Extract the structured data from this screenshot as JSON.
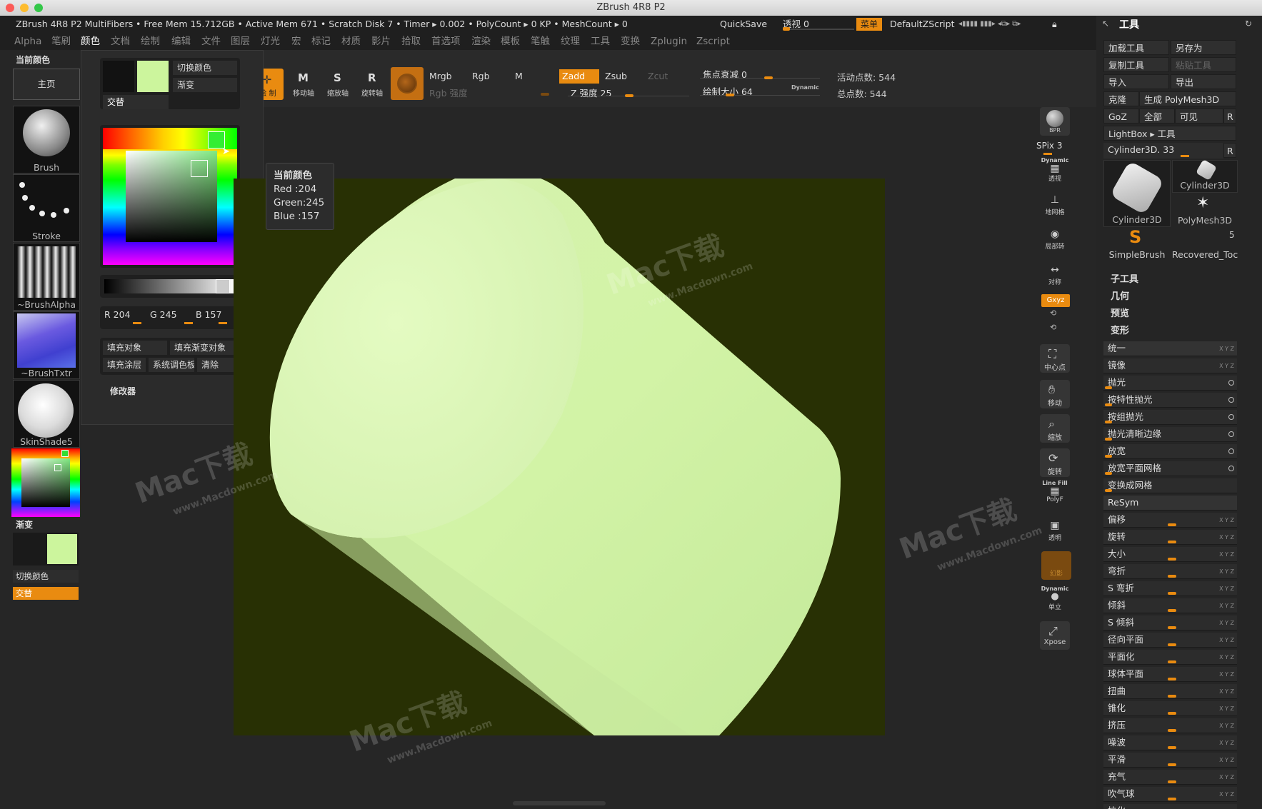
{
  "window_title": "ZBrush 4R8 P2",
  "info": {
    "app_name": "ZBrush 4R8 P2 MultiFibers",
    "stats": "• Free Mem 15.712GB • Active Mem 671 • Scratch Disk 7 • Timer ▸ 0.002 • PolyCount ▸ 0 KP • MeshCount ▸ 0",
    "quicksave": "QuickSave",
    "perspective": "透视 0",
    "menus_btn": "菜单",
    "default_script": "DefaultZScript"
  },
  "menu": [
    "Alpha",
    "笔刷",
    "颜色",
    "文档",
    "绘制",
    "编辑",
    "文件",
    "图层",
    "灯光",
    "宏",
    "标记",
    "材质",
    "影片",
    "拾取",
    "首选项",
    "渲染",
    "模板",
    "笔触",
    "纹理",
    "工具",
    "变换",
    "Zplugin",
    "Zscript"
  ],
  "menu_active_index": 2,
  "shelf": {
    "draw": "绘 制",
    "move": "移动轴",
    "scale": "缩放轴",
    "rotate": "旋转轴",
    "mrgb": "Mrgb",
    "rgb": "Rgb",
    "m": "M",
    "rgb_intensity": "Rgb 强度",
    "zadd": "Zadd",
    "zsub": "Zsub",
    "zcut": "Zcut",
    "z_intensity": "Z 强度 25",
    "focal_shift": "焦点衰减 0",
    "draw_size": "绘制大小 64",
    "dynamic": "Dynamic",
    "active_points": "活动点数: 544",
    "total_points": "总点数: 544"
  },
  "left_tray": {
    "current_color": "当前颜色",
    "home": "主页",
    "brush": "Brush",
    "stroke": "Stroke",
    "alpha": "~BrushAlpha",
    "texture": "~BrushTxtr",
    "material": "SkinShade5",
    "gradient": "渐变",
    "switch_color": "切换颜色",
    "alternate": "交替"
  },
  "color_popup": {
    "switch_color": "切换颜色",
    "gradient": "渐变",
    "alternate": "交替",
    "r": "R 204",
    "g": "G 245",
    "b": "B 157",
    "fill_object": "填充对象",
    "fill_gradient": "填充渐变对象",
    "fill_layer": "填充涂层",
    "sys_palette": "系统调色板",
    "clear": "清除",
    "modifiers": "修改器",
    "current_hex": "#ccf59d"
  },
  "tooltip": {
    "title": "当前颜色",
    "red": "Red  :204",
    "green": "Green:245",
    "blue": "Blue :157"
  },
  "right_shelf": {
    "bpr": "BPR",
    "spix": "SPix 3",
    "dynamic": "Dynamic",
    "persp": "透视",
    "floor": "地网格",
    "local": "局部转",
    "sym": "对称",
    "xyz": "Gxyz",
    "frame": "中心点",
    "move": "移动",
    "zoom": "缩放",
    "rotate": "旋转",
    "linefill": "Line Fill",
    "polyf": "PolyF",
    "transp": "透明",
    "ghost": "幻影",
    "solo": "单立",
    "xpose": "Xpose"
  },
  "tool_panel": {
    "title": "工具",
    "load_tool": "加载工具",
    "save_as": "另存为",
    "copy_tool": "复制工具",
    "paste_tool": "粘贴工具",
    "import": "导入",
    "export": "导出",
    "clone": "克隆",
    "make_polymesh": "生成 PolyMesh3D",
    "goz": "GoZ",
    "all": "全部",
    "visible": "可见",
    "r": "R",
    "lightbox": "LightBox ▸ 工具",
    "current_tool": "Cylinder3D. 33",
    "tools": [
      "Cylinder3D",
      "Cylinder3D",
      "PolyMesh3D",
      "SimpleBrush",
      "Recovered_Toc"
    ],
    "recovered_count": "5",
    "subtool": "子工具",
    "geometry": "几何",
    "preview": "预览",
    "deformation": "变形",
    "deform_items": [
      "统一",
      "镜像",
      "抛光",
      "按特性抛光",
      "按组抛光",
      "抛光清晰边缘",
      "放宽",
      "放宽平面网格",
      "变换成网格",
      "ReSym",
      "偏移",
      "旋转",
      "大小",
      "弯折",
      "S 弯折",
      "倾斜",
      "S 倾斜",
      "径向平面",
      "平面化",
      "球体平面",
      "扭曲",
      "锥化",
      "挤压",
      "噪波",
      "平滑",
      "充气",
      "吹气球",
      "拉化"
    ]
  },
  "watermark": {
    "brand": "Mac下载",
    "url": "www.Macdown.com"
  }
}
